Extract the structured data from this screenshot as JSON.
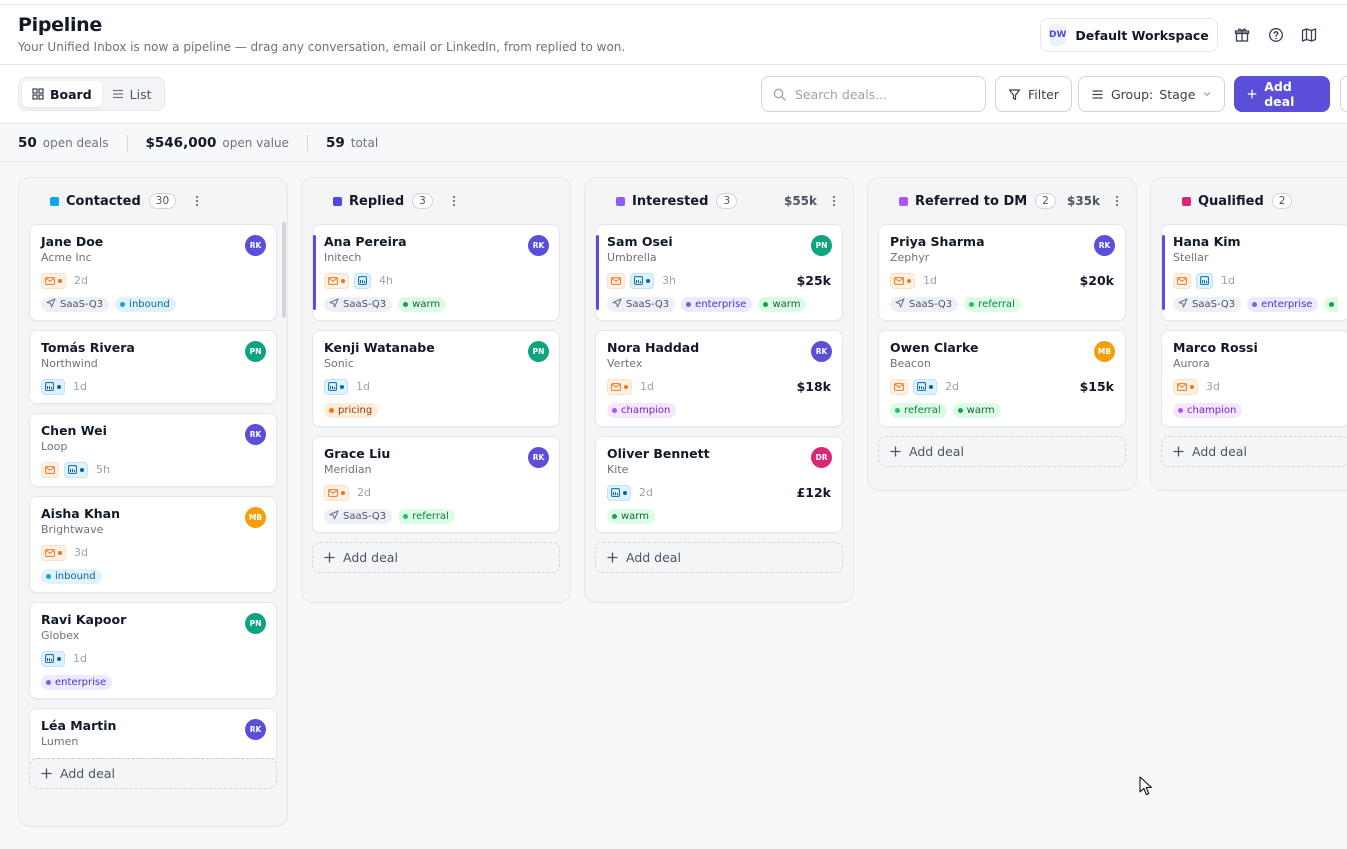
{
  "header": {
    "title": "Pipeline",
    "subtitle": "Your Unified Inbox is now a pipeline — drag any conversation, email or LinkedIn, from replied to won.",
    "workspace": {
      "initials": "DW",
      "name": "Default Workspace"
    },
    "icons": [
      "gift-icon",
      "help-icon",
      "map-icon"
    ]
  },
  "toolbar": {
    "views": [
      {
        "label": "Board",
        "active": true
      },
      {
        "label": "List",
        "active": false
      }
    ],
    "search_placeholder": "Search deals...",
    "filter_label": "Filter",
    "group_label": "Group:",
    "group_value": "Stage",
    "add_deal_label": "Add deal"
  },
  "stats": {
    "open_deals": "50",
    "open_deals_label": "open deals",
    "open_value": "$546,000",
    "open_value_label": "open value",
    "total": "59",
    "total_label": "total"
  },
  "colors": {
    "accent": "#5b4fd9",
    "contacted": "#0ea5e9",
    "replied": "#4f46e5",
    "interested": "#8b5cf6",
    "referred": "#a855f7",
    "qualified": "#db2777",
    "avatar_rk": "#5b4fd9",
    "avatar_pn": "#10a37f",
    "avatar_mb": "#f59e0b",
    "avatar_dr": "#db2777"
  },
  "add_deal_label": "Add deal",
  "columns": [
    {
      "title": "Contacted",
      "count": "30",
      "value": "",
      "color": "#0ea5e9",
      "cards": [
        {
          "name": "Jane Doe",
          "company": "Acme Inc",
          "avatar": "RK",
          "avatar_color": "#5b4fd9",
          "accent": false,
          "channels": [
            "mail-active"
          ],
          "age": "2d",
          "amount": "",
          "tags": [
            {
              "label": "SaaS-Q3",
              "kind": "campaign"
            },
            {
              "label": "inbound",
              "kind": "inbound"
            }
          ]
        },
        {
          "name": "Tomás Rivera",
          "company": "Northwind",
          "avatar": "PN",
          "avatar_color": "#10a37f",
          "accent": false,
          "channels": [
            "li-active"
          ],
          "age": "1d",
          "amount": "",
          "tags": []
        },
        {
          "name": "Chen Wei",
          "company": "Loop",
          "avatar": "RK",
          "avatar_color": "#5b4fd9",
          "accent": false,
          "channels": [
            "mail",
            "li-active"
          ],
          "age": "5h",
          "amount": "",
          "tags": []
        },
        {
          "name": "Aisha Khan",
          "company": "Brightwave",
          "avatar": "MB",
          "avatar_color": "#f59e0b",
          "accent": false,
          "channels": [
            "mail-active"
          ],
          "age": "3d",
          "amount": "",
          "tags": [
            {
              "label": "inbound",
              "kind": "inbound"
            }
          ]
        },
        {
          "name": "Ravi Kapoor",
          "company": "Globex",
          "avatar": "PN",
          "avatar_color": "#10a37f",
          "accent": false,
          "channels": [
            "li-active"
          ],
          "age": "1d",
          "amount": "",
          "tags": [
            {
              "label": "enterprise",
              "kind": "enterprise"
            }
          ]
        },
        {
          "name": "Léa Martin",
          "company": "Lumen",
          "avatar": "RK",
          "avatar_color": "#5b4fd9",
          "accent": false,
          "channels": [],
          "age": "",
          "amount": "",
          "tags": []
        }
      ]
    },
    {
      "title": "Replied",
      "count": "3",
      "value": "",
      "color": "#4f46e5",
      "cards": [
        {
          "name": "Ana Pereira",
          "company": "Initech",
          "avatar": "RK",
          "avatar_color": "#5b4fd9",
          "accent": true,
          "channels": [
            "mail-active",
            "li"
          ],
          "age": "4h",
          "amount": "",
          "tags": [
            {
              "label": "SaaS-Q3",
              "kind": "campaign"
            },
            {
              "label": "warm",
              "kind": "warm"
            }
          ]
        },
        {
          "name": "Kenji Watanabe",
          "company": "Sonic",
          "avatar": "PN",
          "avatar_color": "#10a37f",
          "accent": false,
          "channels": [
            "li-active"
          ],
          "age": "1d",
          "amount": "",
          "tags": [
            {
              "label": "pricing",
              "kind": "pricing"
            }
          ]
        },
        {
          "name": "Grace Liu",
          "company": "Meridian",
          "avatar": "RK",
          "avatar_color": "#5b4fd9",
          "accent": false,
          "channels": [
            "mail-active"
          ],
          "age": "2d",
          "amount": "",
          "tags": [
            {
              "label": "SaaS-Q3",
              "kind": "campaign"
            },
            {
              "label": "referral",
              "kind": "referral"
            }
          ]
        }
      ]
    },
    {
      "title": "Interested",
      "count": "3",
      "value": "$55k",
      "color": "#8b5cf6",
      "cards": [
        {
          "name": "Sam Osei",
          "company": "Umbrella",
          "avatar": "PN",
          "avatar_color": "#10a37f",
          "accent": true,
          "channels": [
            "mail",
            "li-active"
          ],
          "age": "3h",
          "amount": "$25k",
          "tags": [
            {
              "label": "SaaS-Q3",
              "kind": "campaign"
            },
            {
              "label": "enterprise",
              "kind": "enterprise"
            },
            {
              "label": "warm",
              "kind": "warm"
            }
          ]
        },
        {
          "name": "Nora Haddad",
          "company": "Vertex",
          "avatar": "RK",
          "avatar_color": "#5b4fd9",
          "accent": false,
          "channels": [
            "mail-active"
          ],
          "age": "1d",
          "amount": "$18k",
          "tags": [
            {
              "label": "champion",
              "kind": "champion"
            }
          ]
        },
        {
          "name": "Oliver Bennett",
          "company": "Kite",
          "avatar": "DR",
          "avatar_color": "#db2777",
          "accent": false,
          "channels": [
            "li-active"
          ],
          "age": "2d",
          "amount": "£12k",
          "tags": [
            {
              "label": "warm",
              "kind": "warm"
            }
          ]
        }
      ]
    },
    {
      "title": "Referred to DM",
      "count": "2",
      "value": "$35k",
      "color": "#a855f7",
      "cards": [
        {
          "name": "Priya Sharma",
          "company": "Zephyr",
          "avatar": "RK",
          "avatar_color": "#5b4fd9",
          "accent": false,
          "channels": [
            "mail-active"
          ],
          "age": "1d",
          "amount": "$20k",
          "tags": [
            {
              "label": "SaaS-Q3",
              "kind": "campaign"
            },
            {
              "label": "referral",
              "kind": "referral"
            }
          ]
        },
        {
          "name": "Owen Clarke",
          "company": "Beacon",
          "avatar": "MB",
          "avatar_color": "#f59e0b",
          "accent": false,
          "channels": [
            "mail",
            "li-active"
          ],
          "age": "2d",
          "amount": "$15k",
          "tags": [
            {
              "label": "referral",
              "kind": "referral"
            },
            {
              "label": "warm",
              "kind": "warm"
            }
          ]
        }
      ]
    },
    {
      "title": "Qualified",
      "count": "2",
      "value": "",
      "color": "#db2777",
      "cards": [
        {
          "name": "Hana Kim",
          "company": "Stellar",
          "avatar": "",
          "avatar_color": "#5b4fd9",
          "accent": true,
          "channels": [
            "mail",
            "li"
          ],
          "age": "1d",
          "amount": "",
          "tags": [
            {
              "label": "SaaS-Q3",
              "kind": "campaign"
            },
            {
              "label": "enterprise",
              "kind": "enterprise"
            },
            {
              "label": "w",
              "kind": "warm"
            }
          ]
        },
        {
          "name": "Marco Rossi",
          "company": "Aurora",
          "avatar": "",
          "avatar_color": "#f59e0b",
          "accent": false,
          "channels": [
            "mail-active"
          ],
          "age": "3d",
          "amount": "",
          "tags": [
            {
              "label": "champion",
              "kind": "champion"
            }
          ]
        }
      ]
    }
  ]
}
